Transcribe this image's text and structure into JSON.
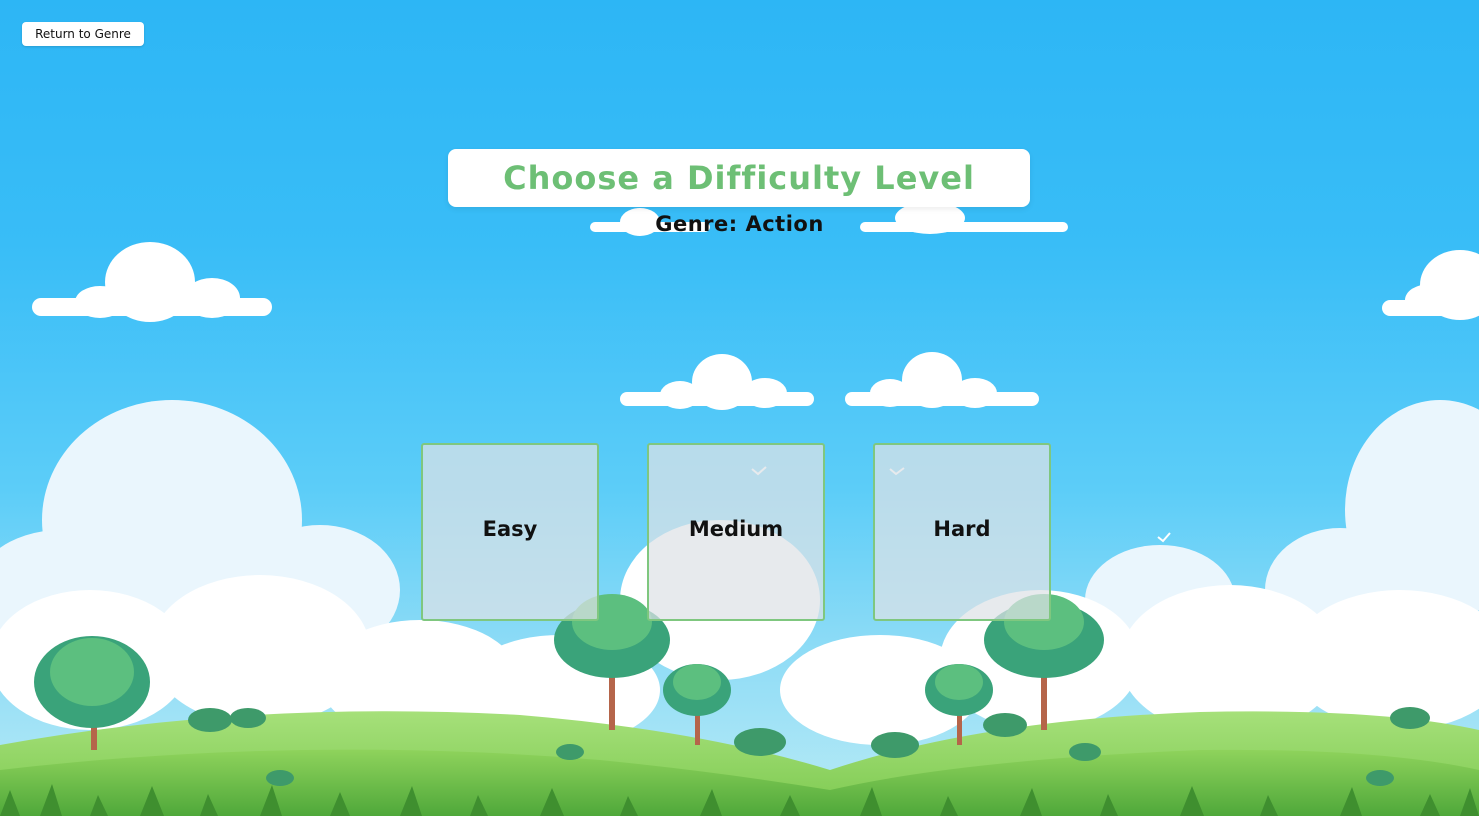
{
  "nav": {
    "back_label": "Return to Genre"
  },
  "header": {
    "title": "Choose a Difficulty Level",
    "genre_line": "Genre: Action"
  },
  "levels": [
    {
      "label": "Easy"
    },
    {
      "label": "Medium"
    },
    {
      "label": "Hard"
    }
  ],
  "colors": {
    "sky": "#2db6f5",
    "title_text": "#6dbf75",
    "card_border": "#7fc77f",
    "grass": "#7cc94f"
  }
}
